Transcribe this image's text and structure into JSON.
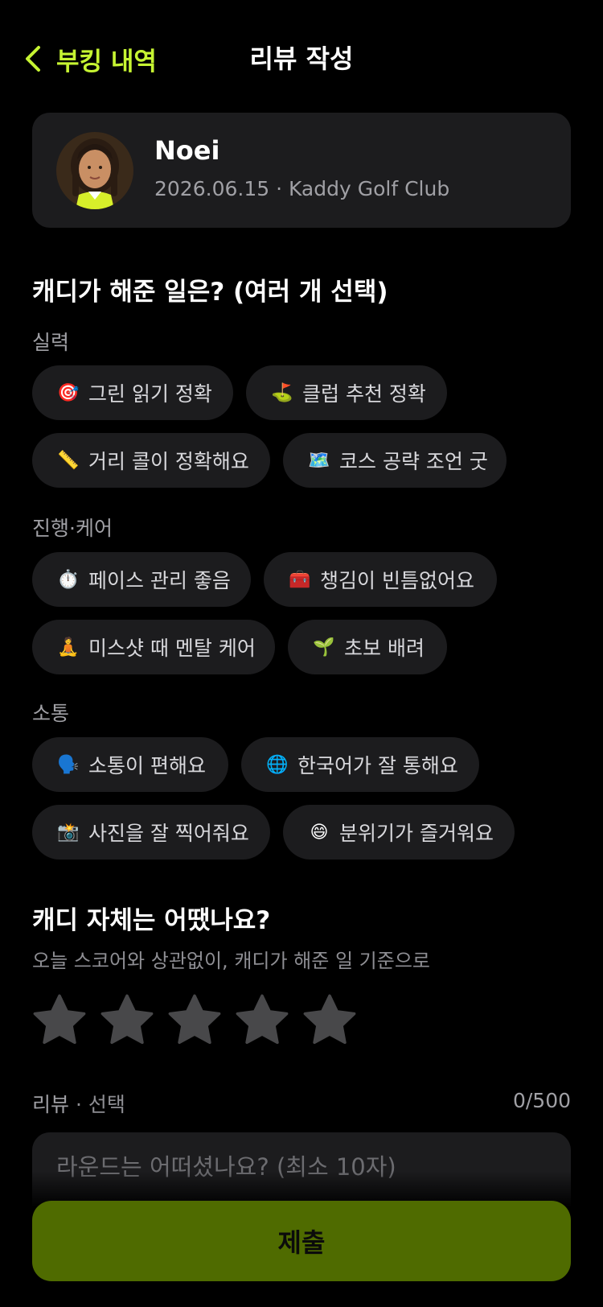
{
  "nav": {
    "back_label": "부킹 내역",
    "title": "리뷰 작성"
  },
  "booking": {
    "caddy_name": "Noei",
    "meta": "2026.06.15 · Kaddy Golf Club"
  },
  "tasks": {
    "title": "캐디가 해준 일은? (여러 개 선택)",
    "groups": [
      {
        "label": "실력",
        "chips": [
          {
            "emoji": "🎯",
            "label": "그린 읽기 정확"
          },
          {
            "emoji": "⛳",
            "label": "클럽 추천 정확"
          },
          {
            "emoji": "📏",
            "label": "거리 콜이 정확해요"
          },
          {
            "emoji": "🗺️",
            "label": "코스 공략 조언 굿"
          }
        ]
      },
      {
        "label": "진행·케어",
        "chips": [
          {
            "emoji": "⏱️",
            "label": "페이스 관리 좋음"
          },
          {
            "emoji": "🧰",
            "label": "챙김이 빈틈없어요"
          },
          {
            "emoji": "🧘",
            "label": "미스샷 때 멘탈 케어"
          },
          {
            "emoji": "🌱",
            "label": "초보 배려"
          }
        ]
      },
      {
        "label": "소통",
        "chips": [
          {
            "emoji": "🗣️",
            "label": "소통이 편해요"
          },
          {
            "emoji": "🌐",
            "label": "한국어가 잘 통해요"
          },
          {
            "emoji": "📸",
            "label": "사진을 잘 찍어줘요"
          },
          {
            "emoji": "😄",
            "label": "분위기가 즐거워요"
          }
        ]
      }
    ]
  },
  "rating": {
    "title": "캐디 자체는 어땠나요?",
    "subtitle": "오늘 스코어와 상관없이, 캐디가 해준 일 기준으로",
    "value": 0,
    "max": 5
  },
  "review": {
    "label": "리뷰",
    "optional": " · 선택",
    "count": "0/500",
    "placeholder": "라운드는 어떠셨나요? (최소 10자)"
  },
  "submit": {
    "label": "제출"
  },
  "colors": {
    "accent": "#c6f432",
    "submit_bg": "#4f6b00",
    "card_bg": "#1c1c1e",
    "star_inactive": "#48484a"
  },
  "icons": {
    "back": "chevron-left-icon",
    "star": "star-icon"
  }
}
